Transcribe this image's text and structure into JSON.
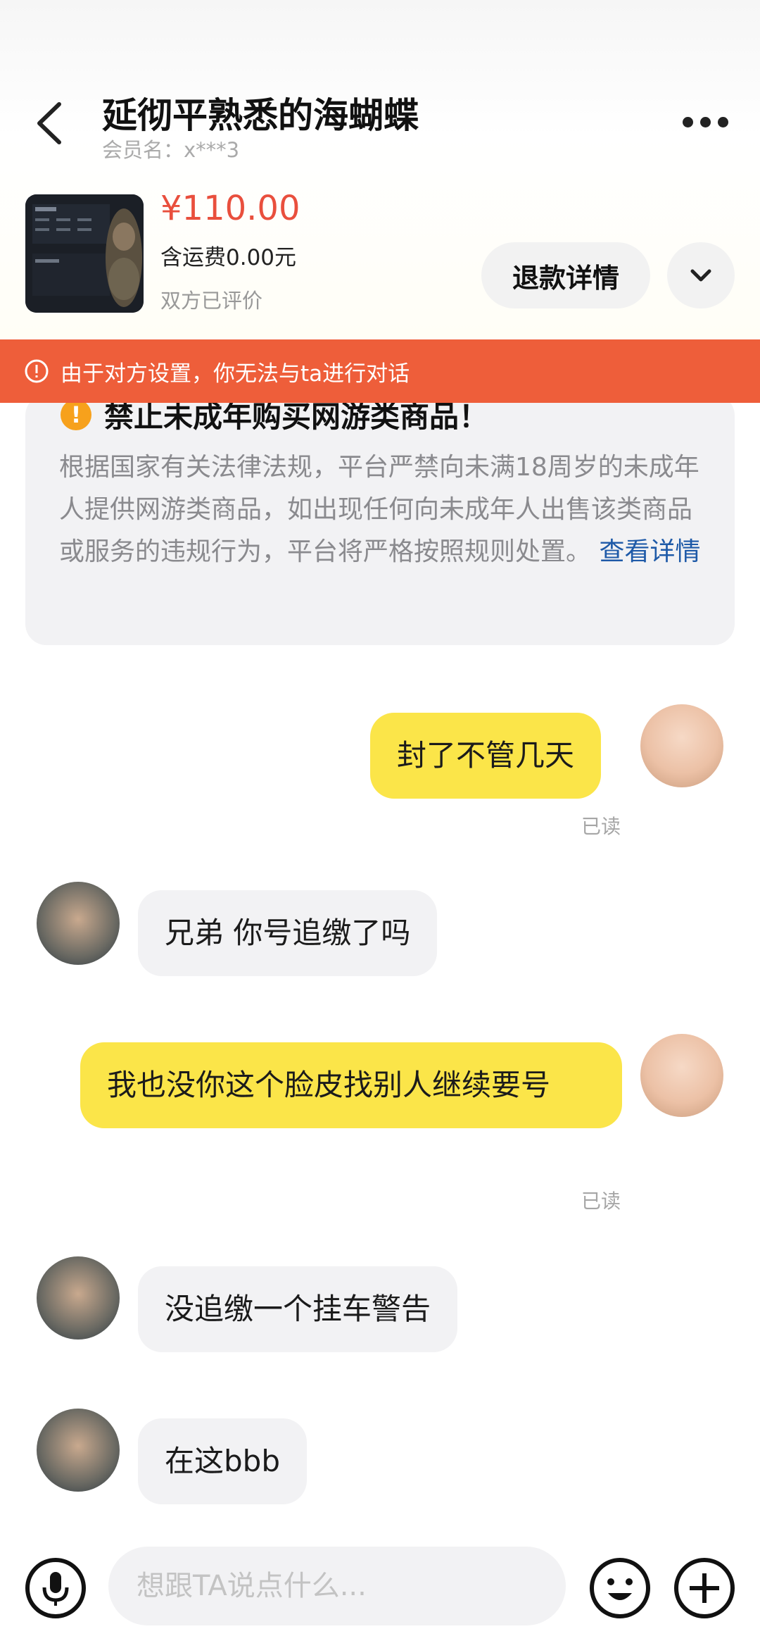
{
  "header": {
    "title": "延彻平熟悉的海蝴蝶",
    "member_name": "会员名：x***3"
  },
  "product": {
    "price": "¥110.00",
    "shipping": "含运费0.00元",
    "review_status": "双方已评价",
    "refund_label": "退款详情"
  },
  "banner": {
    "text": "由于对方设置，你无法与ta进行对话",
    "color": "#ee5e3a"
  },
  "notice": {
    "title": "禁止未成年购买网游类商品！",
    "body": "根据国家有关法律法规，平台严禁向未满18周岁的未成年人提供网游类商品，如出现任何向未成年人出售该类商品或服务的违规行为，平台将严格按照规则处置。",
    "link": "查看详情"
  },
  "messages": [
    {
      "sender": "me",
      "text": "封了不管几天",
      "status": "已读"
    },
    {
      "sender": "other",
      "text": "兄弟 你号追缴了吗"
    },
    {
      "sender": "me",
      "text": "我也没你这个脸皮找别人继续要号",
      "status": "已读"
    },
    {
      "sender": "other",
      "text": "没追缴一个挂车警告"
    },
    {
      "sender": "other",
      "text": "在这bbb"
    }
  ],
  "composer": {
    "placeholder": "想跟TA说点什么..."
  },
  "icons": {
    "back": "back-arrow-icon",
    "more": "more-dots-icon",
    "expand": "chevron-down-icon",
    "alert": "alert-circle-icon",
    "mic": "microphone-icon",
    "emoji": "emoji-icon",
    "plus": "plus-icon"
  },
  "colors": {
    "my_bubble": "#fbe549",
    "other_bubble": "#f2f2f4",
    "price": "#e94f3d",
    "link": "#1e5aa8"
  }
}
